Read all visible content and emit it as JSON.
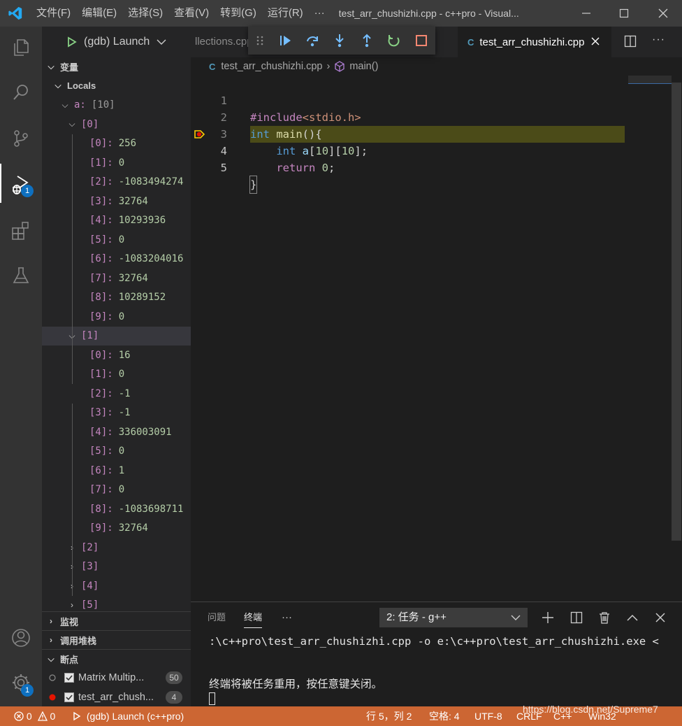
{
  "titlebar": {
    "menus": [
      "文件(F)",
      "编辑(E)",
      "选择(S)",
      "查看(V)",
      "转到(G)",
      "运行(R)",
      "···"
    ],
    "title": "test_arr_chushizhi.cpp - c++pro - Visual..."
  },
  "activity": {
    "debug_badge": "1",
    "settings_badge": "1"
  },
  "debug_view": {
    "launch_config": "(gdb) Launch",
    "variables_header": "变量",
    "locals_header": "Locals",
    "var_a": {
      "name": "a:",
      "value": "[10]"
    },
    "group0": {
      "label": "[0]",
      "items": [
        {
          "k": "[0]:",
          "v": "256"
        },
        {
          "k": "[1]:",
          "v": "0"
        },
        {
          "k": "[2]:",
          "v": "-1083494274"
        },
        {
          "k": "[3]:",
          "v": "32764"
        },
        {
          "k": "[4]:",
          "v": "10293936"
        },
        {
          "k": "[5]:",
          "v": "0"
        },
        {
          "k": "[6]:",
          "v": "-1083204016"
        },
        {
          "k": "[7]:",
          "v": "32764"
        },
        {
          "k": "[8]:",
          "v": "10289152"
        },
        {
          "k": "[9]:",
          "v": "0"
        }
      ]
    },
    "group1": {
      "label": "[1]",
      "items": [
        {
          "k": "[0]:",
          "v": "16"
        },
        {
          "k": "[1]:",
          "v": "0"
        },
        {
          "k": "[2]:",
          "v": "-1"
        },
        {
          "k": "[3]:",
          "v": "-1"
        },
        {
          "k": "[4]:",
          "v": "336003091"
        },
        {
          "k": "[5]:",
          "v": "0"
        },
        {
          "k": "[6]:",
          "v": "1"
        },
        {
          "k": "[7]:",
          "v": "0"
        },
        {
          "k": "[8]:",
          "v": "-1083698711"
        },
        {
          "k": "[9]:",
          "v": "32764"
        }
      ]
    },
    "collapsed_groups": [
      "[2]",
      "[3]",
      "[4]",
      "[5]"
    ],
    "watch_header": "监视",
    "callstack_header": "调用堆栈",
    "breakpoints_header": "断点",
    "breakpoints": [
      {
        "label": "Matrix Multip...",
        "count": "50"
      },
      {
        "label": "test_arr_chush...",
        "count": "4"
      }
    ]
  },
  "editor": {
    "tab_other": "llections.cpp",
    "tab_active": "test_arr_chushizhi.cpp",
    "breadcrumb_file": "test_arr_chushizhi.cpp",
    "breadcrumb_symbol": "main()",
    "line_numbers": [
      "1",
      "2",
      "3",
      "4",
      "5"
    ],
    "code": {
      "l1_directive": "#include",
      "l1_header": "<stdio.h>",
      "l2_type": "int",
      "l2_fn": "main",
      "l2_rest": "(){",
      "l3_type": "int",
      "l3_var": "a",
      "l3_n1": "10",
      "l3_n2": "10",
      "l4_kw": "return",
      "l4_num": "0",
      "l5": "}"
    }
  },
  "panel": {
    "tab_problems": "问题",
    "tab_terminal": "终端",
    "more": "···",
    "terminal_select": "2: 任务 - g++",
    "line1": ":\\c++pro\\test_arr_chushizhi.cpp -o e:\\c++pro\\test_arr_chushizhi.exe <",
    "line2": "终端将被任务重用，按任意键关闭。"
  },
  "statusbar": {
    "errors": "0",
    "warnings": "0",
    "debug_target": "(gdb) Launch (c++pro)",
    "cursor": "行 5，列 2",
    "indent": "空格: 4",
    "encoding": "UTF-8",
    "eol": "CRLF",
    "language": "C++",
    "platform": "Win32",
    "watermark": "https://blog.csdn.net/Supreme7"
  },
  "colors": {
    "statusbar_debug": "#cc6633",
    "current_line": "#4b4b18",
    "badge": "#0e70c0"
  }
}
